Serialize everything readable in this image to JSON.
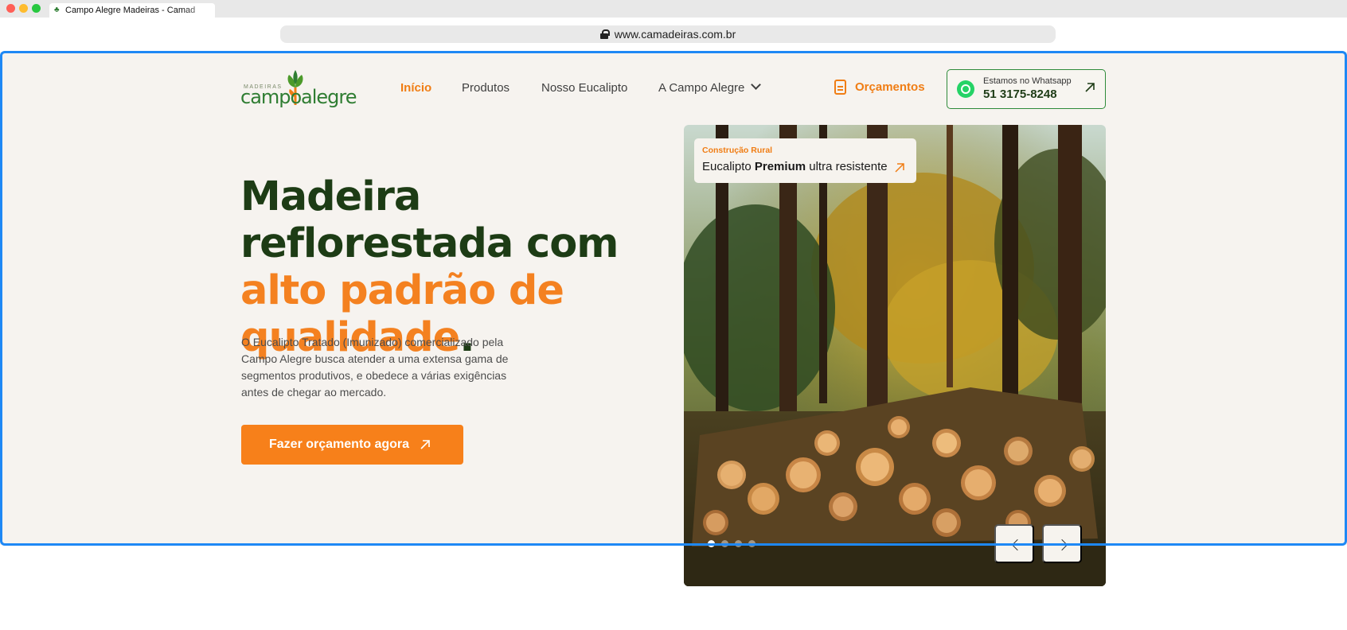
{
  "browser": {
    "tab_title": "Campo Alegre Madeiras - Camad",
    "url": "www.camadeiras.com.br"
  },
  "logo": {
    "small": "MADEIRAS",
    "word1": "campo",
    "word2": "alegre"
  },
  "nav": {
    "items": [
      {
        "label": "Início",
        "active": true
      },
      {
        "label": "Produtos"
      },
      {
        "label": "Nosso Eucalipto"
      },
      {
        "label": "A Campo Alegre",
        "dropdown": true
      }
    ],
    "quote_link": "Orçamentos",
    "whatsapp": {
      "line1": "Estamos no Whatsapp",
      "phone": "51 3175-8248"
    }
  },
  "hero": {
    "headline_part1": "Madeira reflorestada com ",
    "headline_highlight": "alto padrão de qualidade",
    "headline_end": ".",
    "description": "O Eucalipto Tratado (Imunizado) comercializado pela Campo Alegre busca atender a uma extensa gama de segmentos produtivos, e obedece a várias exigências antes de chegar ao mercado.",
    "cta_label": "Fazer orçamento agora"
  },
  "slider": {
    "badge_category": "Construção Rural",
    "badge_text_pre": "Eucalipto ",
    "badge_text_bold": "Premium",
    "badge_text_post": " ultra resistente",
    "slide_count": 4,
    "active_slide": 1
  },
  "colors": {
    "accent_orange": "#f7801a",
    "dark_green": "#1d3c15",
    "brand_green": "#2f7d32",
    "hero_bg": "#f6f3ef",
    "outline_blue": "#1e88f5"
  },
  "icons": [
    "lock-icon",
    "logo-leaf-icon",
    "document-icon",
    "whatsapp-icon",
    "arrow-up-right-icon",
    "chevron-down-icon",
    "chevron-left-icon",
    "chevron-right-icon"
  ]
}
